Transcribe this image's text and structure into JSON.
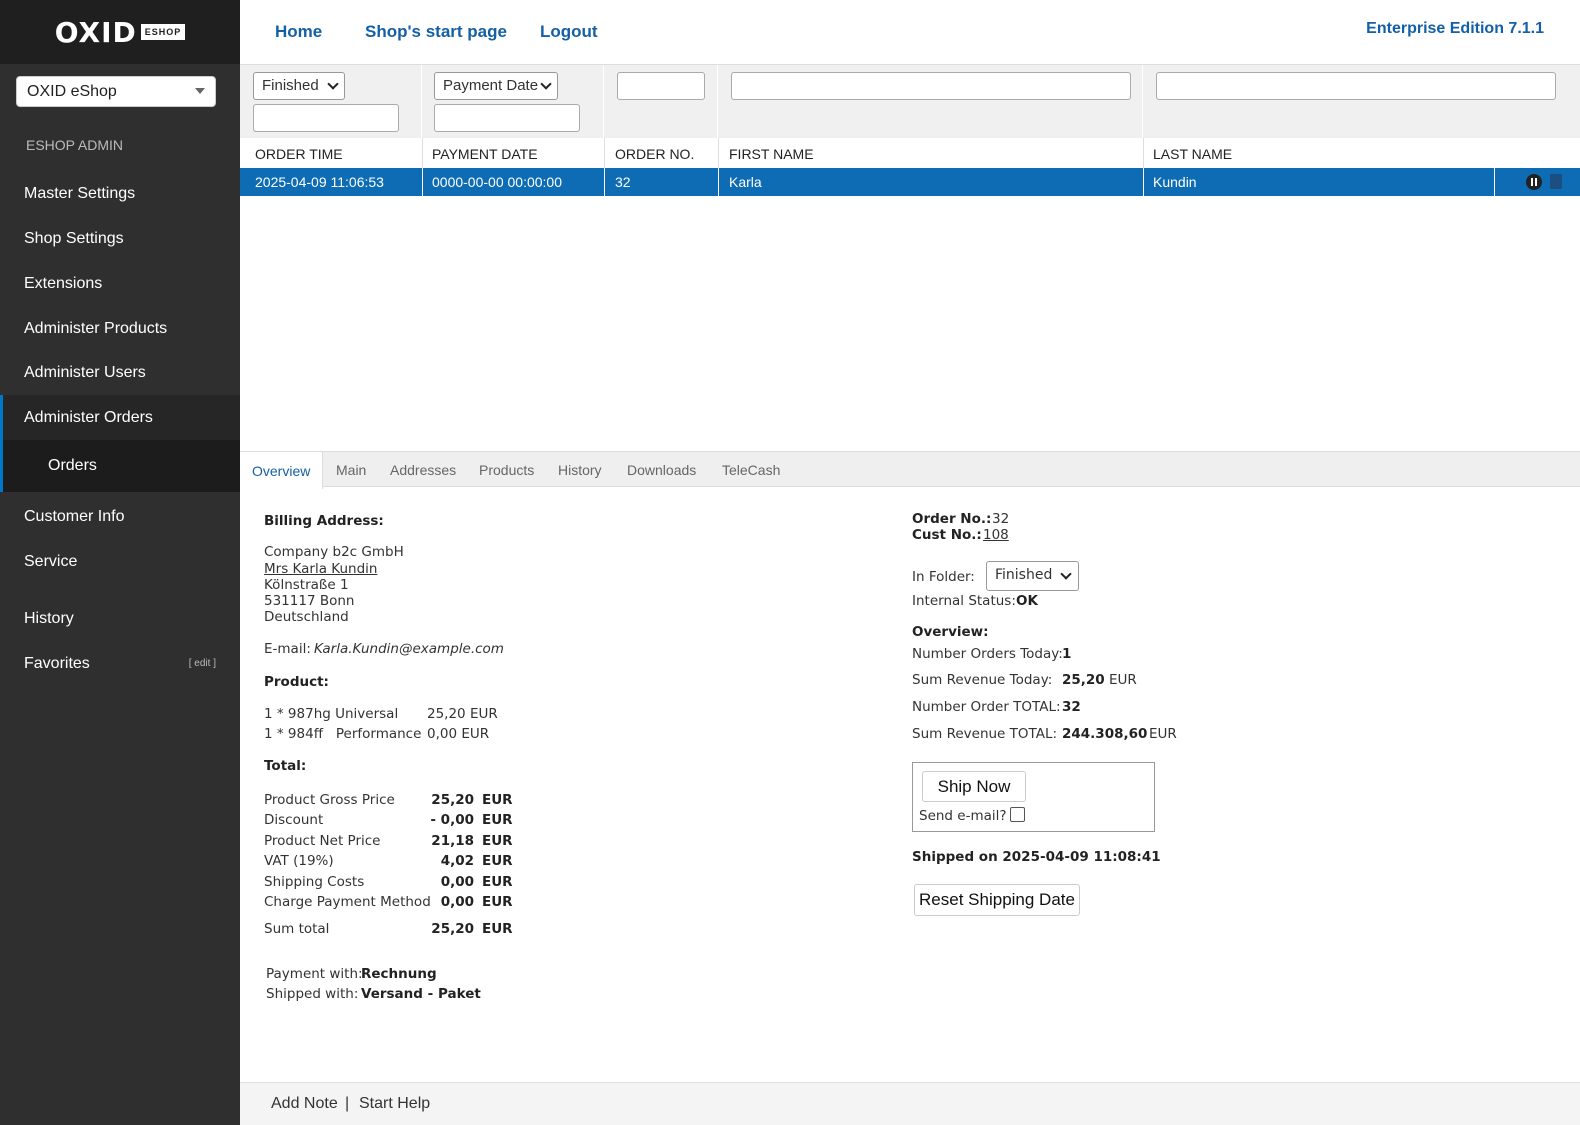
{
  "sidebar": {
    "logo_text": "OXID",
    "logo_badge": "ESHOP",
    "shop_select": "OXID eShop",
    "heading": "ESHOP ADMIN",
    "items": [
      {
        "label": "Master Settings"
      },
      {
        "label": "Shop Settings"
      },
      {
        "label": "Extensions"
      },
      {
        "label": "Administer Products"
      },
      {
        "label": "Administer Users"
      },
      {
        "label": "Administer Orders"
      },
      {
        "label": "Orders"
      },
      {
        "label": "Customer Info"
      },
      {
        "label": "Service"
      },
      {
        "label": "History"
      },
      {
        "label": "Favorites"
      }
    ],
    "favorites_edit": "[ edit ]"
  },
  "header": {
    "home": "Home",
    "start_page": "Shop's start page",
    "logout": "Logout",
    "edition": "Enterprise Edition 7.1.1"
  },
  "filters": {
    "folder": "Finished",
    "date_type": "Payment Date"
  },
  "table": {
    "columns": [
      "ORDER TIME",
      "PAYMENT DATE",
      "ORDER NO.",
      "FIRST NAME",
      "LAST NAME"
    ],
    "rows": [
      {
        "order_time": "2025-04-09 11:06:53",
        "payment_date": "0000-00-00 00:00:00",
        "order_no": "32",
        "first_name": "Karla",
        "last_name": "Kundin"
      }
    ]
  },
  "tabs": [
    "Overview",
    "Main",
    "Addresses",
    "Products",
    "History",
    "Downloads",
    "TeleCash"
  ],
  "overview": {
    "billing_title": "Billing Address:",
    "billing": {
      "company": "Company b2c GmbH",
      "name": "Mrs Karla Kundin",
      "street": "Kölnstraße 1",
      "city": "531117 Bonn",
      "country": "Deutschland"
    },
    "email_label": "E-mail:",
    "email": "Karla.Kundin@example.com",
    "product_title": "Product:",
    "products": [
      {
        "name": "1 * 987hg Universal",
        "price": "25,20 EUR"
      },
      {
        "name": "1 * 984ff   Performance",
        "price": "0,00 EUR"
      }
    ],
    "total_title": "Total:",
    "totals": [
      {
        "label": "Product Gross Price",
        "value": "25,20",
        "cur": "EUR"
      },
      {
        "label": "Discount",
        "value": "- 0,00",
        "cur": "EUR"
      },
      {
        "label": "Product Net Price",
        "value": "21,18",
        "cur": "EUR"
      },
      {
        "label": "VAT (19%)",
        "value": "4,02",
        "cur": "EUR"
      },
      {
        "label": "Shipping Costs",
        "value": "0,00",
        "cur": "EUR"
      },
      {
        "label": "Charge Payment Method",
        "value": "0,00",
        "cur": "EUR"
      },
      {
        "label": "Sum total",
        "value": "25,20",
        "cur": "EUR"
      }
    ],
    "payment_label": "Payment with:",
    "payment_value": "Rechnung",
    "shipped_label": "Shipped with:",
    "shipped_value": "Versand - Paket",
    "order_no_label": "Order No.:",
    "order_no": "32",
    "cust_no_label": "Cust No.:",
    "cust_no": "108",
    "folder_label": "In Folder:",
    "folder_value": "Finished",
    "internal_status_label": "Internal Status:",
    "internal_status": "OK",
    "overview_title": "Overview:",
    "stats": [
      {
        "label": "Number Orders Today:",
        "value": "1",
        "cur": ""
      },
      {
        "label": "Sum Revenue Today:",
        "value": "25,20",
        "cur": "EUR"
      },
      {
        "label": "Number Order TOTAL:",
        "value": "32",
        "cur": ""
      },
      {
        "label": "Sum Revenue TOTAL:",
        "value": "244.308,60",
        "cur": "EUR"
      }
    ],
    "ship_now": "Ship Now",
    "send_email": "Send e-mail?",
    "shipped_on": "Shipped on 2025-04-09 11:08:41",
    "reset_shipping": "Reset Shipping Date"
  },
  "footer": {
    "add_note": "Add Note",
    "separator": "|",
    "start_help": "Start Help"
  }
}
